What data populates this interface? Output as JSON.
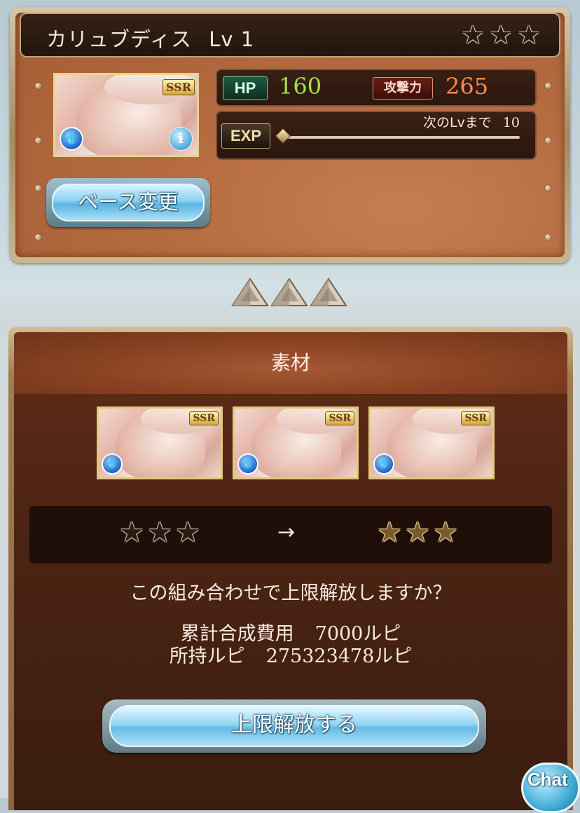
{
  "character": {
    "name": "カリュブディス",
    "level_text": "Lv 1",
    "rarity_badge": "SSR",
    "element_icon": "water-icon",
    "stars_filled": 0,
    "stars_total": 3
  },
  "stats": {
    "hp_label": "HP",
    "hp_value": "160",
    "atk_label": "攻撃力",
    "atk_value": "265",
    "exp_label": "EXP",
    "next_lv_label": "次のLvまで",
    "next_lv_value": "10",
    "exp_progress": 0
  },
  "buttons": {
    "base_change": "ベース変更",
    "unlock": "上限解放する",
    "chat": "Chat"
  },
  "materials": {
    "title": "素材",
    "cards": [
      {
        "rarity_badge": "SSR",
        "element_icon": "water-icon"
      },
      {
        "rarity_badge": "SSR",
        "element_icon": "water-icon"
      },
      {
        "rarity_badge": "SSR",
        "element_icon": "water-icon"
      }
    ]
  },
  "compare": {
    "before_stars": "empty",
    "after_stars": "half",
    "arrow": "→"
  },
  "confirm": {
    "question": "この組み合わせで上限解放しますか？",
    "cost_label": "累計合成費用",
    "cost_value": "7000ルピ",
    "owned_label": "所持ルピ",
    "owned_value": "275323478ルピ"
  },
  "colors": {
    "hp_value": "#a4e14b",
    "atk_value": "#ff8c4f",
    "panel_brown": "#a55c34",
    "button_blue": "#5cb3e2"
  }
}
